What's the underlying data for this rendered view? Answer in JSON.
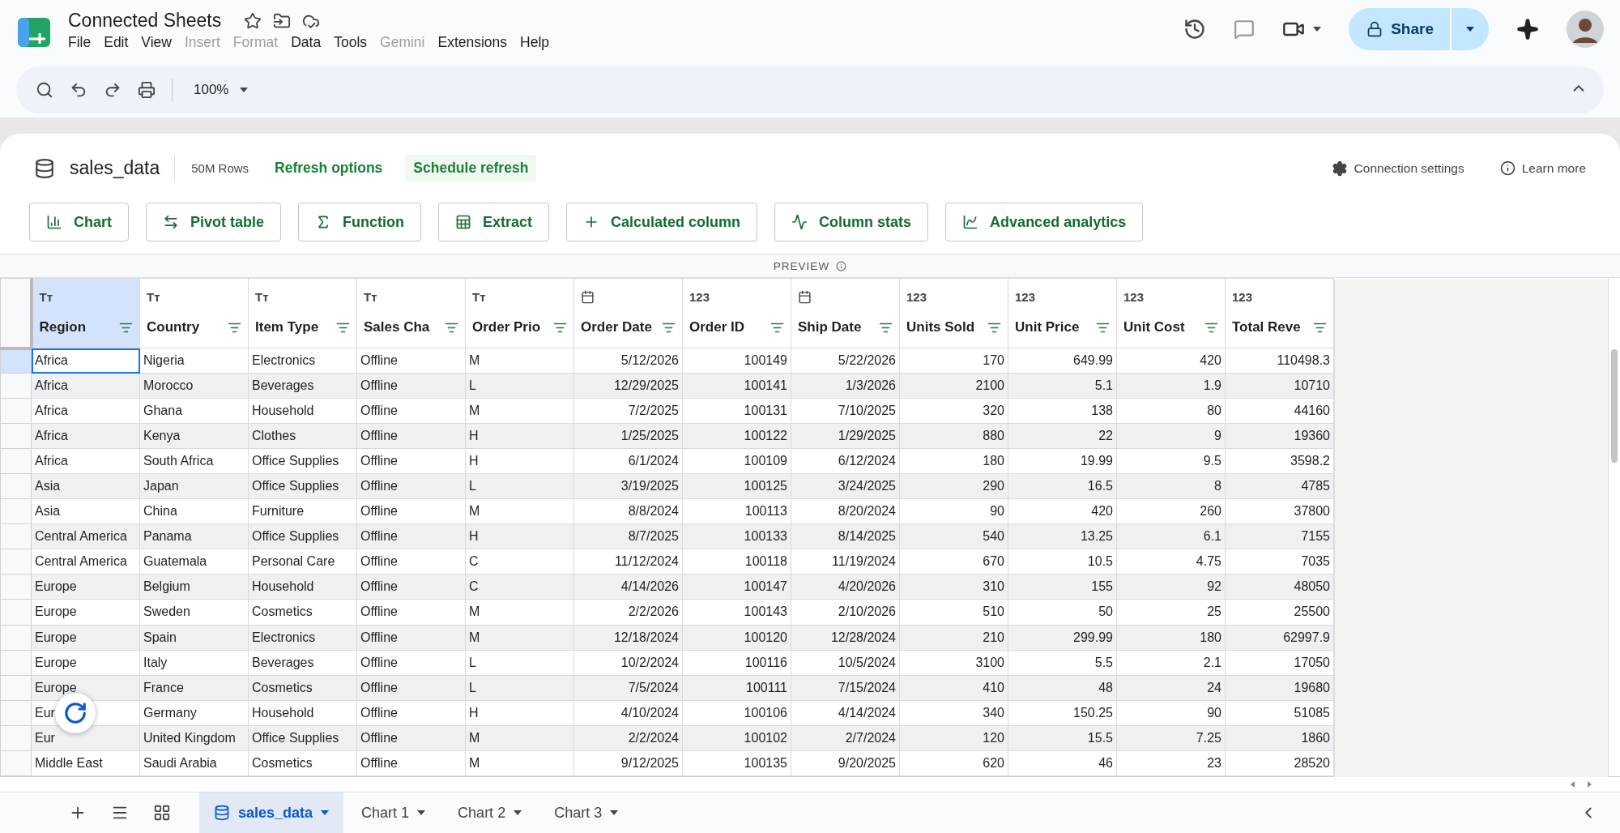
{
  "doc": {
    "title": "Connected Sheets"
  },
  "menu": [
    {
      "label": "File",
      "disabled": false
    },
    {
      "label": "Edit",
      "disabled": false
    },
    {
      "label": "View",
      "disabled": false
    },
    {
      "label": "Insert",
      "disabled": true
    },
    {
      "label": "Format",
      "disabled": true
    },
    {
      "label": "Data",
      "disabled": false
    },
    {
      "label": "Tools",
      "disabled": false
    },
    {
      "label": "Gemini",
      "disabled": true
    },
    {
      "label": "Extensions",
      "disabled": false
    },
    {
      "label": "Help",
      "disabled": false
    }
  ],
  "share": {
    "label": "Share"
  },
  "toolbar": {
    "zoom": "100%"
  },
  "source": {
    "name": "sales_data",
    "rows": "50M Rows",
    "links": [
      "Refresh options",
      "Schedule refresh"
    ],
    "settings": "Connection settings",
    "learn": "Learn more"
  },
  "actions": [
    "Chart",
    "Pivot table",
    "Function",
    "Extract",
    "Calculated column",
    "Column stats",
    "Advanced analytics"
  ],
  "preview": "PREVIEW",
  "table": {
    "columns": [
      {
        "name": "Region",
        "kind": "text",
        "type_label": "Tт",
        "selected": true
      },
      {
        "name": "Country",
        "kind": "text",
        "type_label": "Tт",
        "selected": false
      },
      {
        "name": "Item Type",
        "kind": "text",
        "type_label": "Tт",
        "selected": false
      },
      {
        "name": "Sales Cha",
        "kind": "text",
        "type_label": "Tт",
        "selected": false
      },
      {
        "name": "Order Prio",
        "kind": "text",
        "type_label": "Tт",
        "selected": false
      },
      {
        "name": "Order Date",
        "kind": "date",
        "selected": false
      },
      {
        "name": "Order ID",
        "kind": "number",
        "type_label": "123",
        "selected": false
      },
      {
        "name": "Ship Date",
        "kind": "date",
        "selected": false
      },
      {
        "name": "Units Sold",
        "kind": "number",
        "type_label": "123",
        "selected": false
      },
      {
        "name": "Unit Price",
        "kind": "number",
        "type_label": "123",
        "selected": false
      },
      {
        "name": "Unit Cost",
        "kind": "number",
        "type_label": "123",
        "selected": false
      },
      {
        "name": "Total Reve",
        "kind": "number",
        "type_label": "123",
        "selected": false
      }
    ],
    "rows": [
      {
        "selected": true,
        "cells": [
          "Africa",
          "Nigeria",
          "Electronics",
          "Offline",
          "M",
          "5/12/2026",
          "100149",
          "5/22/2026",
          "170",
          "649.99",
          "420",
          "110498.3"
        ]
      },
      {
        "selected": false,
        "cells": [
          "Africa",
          "Morocco",
          "Beverages",
          "Offline",
          "L",
          "12/29/2025",
          "100141",
          "1/3/2026",
          "2100",
          "5.1",
          "1.9",
          "10710"
        ]
      },
      {
        "selected": false,
        "cells": [
          "Africa",
          "Ghana",
          "Household",
          "Offline",
          "M",
          "7/2/2025",
          "100131",
          "7/10/2025",
          "320",
          "138",
          "80",
          "44160"
        ]
      },
      {
        "selected": false,
        "cells": [
          "Africa",
          "Kenya",
          "Clothes",
          "Offline",
          "H",
          "1/25/2025",
          "100122",
          "1/29/2025",
          "880",
          "22",
          "9",
          "19360"
        ]
      },
      {
        "selected": false,
        "cells": [
          "Africa",
          "South Africa",
          "Office Supplies",
          "Offline",
          "H",
          "6/1/2024",
          "100109",
          "6/12/2024",
          "180",
          "19.99",
          "9.5",
          "3598.2"
        ]
      },
      {
        "selected": false,
        "cells": [
          "Asia",
          "Japan",
          "Office Supplies",
          "Offline",
          "L",
          "3/19/2025",
          "100125",
          "3/24/2025",
          "290",
          "16.5",
          "8",
          "4785"
        ]
      },
      {
        "selected": false,
        "cells": [
          "Asia",
          "China",
          "Furniture",
          "Offline",
          "M",
          "8/8/2024",
          "100113",
          "8/20/2024",
          "90",
          "420",
          "260",
          "37800"
        ]
      },
      {
        "selected": false,
        "cells": [
          "Central America",
          "Panama",
          "Office Supplies",
          "Offline",
          "H",
          "8/7/2025",
          "100133",
          "8/14/2025",
          "540",
          "13.25",
          "6.1",
          "7155"
        ]
      },
      {
        "selected": false,
        "cells": [
          "Central America",
          "Guatemala",
          "Personal Care",
          "Offline",
          "C",
          "11/12/2024",
          "100118",
          "11/19/2024",
          "670",
          "10.5",
          "4.75",
          "7035"
        ]
      },
      {
        "selected": false,
        "cells": [
          "Europe",
          "Belgium",
          "Household",
          "Offline",
          "C",
          "4/14/2026",
          "100147",
          "4/20/2026",
          "310",
          "155",
          "92",
          "48050"
        ]
      },
      {
        "selected": false,
        "cells": [
          "Europe",
          "Sweden",
          "Cosmetics",
          "Offline",
          "M",
          "2/2/2026",
          "100143",
          "2/10/2026",
          "510",
          "50",
          "25",
          "25500"
        ]
      },
      {
        "selected": false,
        "cells": [
          "Europe",
          "Spain",
          "Electronics",
          "Offline",
          "M",
          "12/18/2024",
          "100120",
          "12/28/2024",
          "210",
          "299.99",
          "180",
          "62997.9"
        ]
      },
      {
        "selected": false,
        "cells": [
          "Europe",
          "Italy",
          "Beverages",
          "Offline",
          "L",
          "10/2/2024",
          "100116",
          "10/5/2024",
          "3100",
          "5.5",
          "2.1",
          "17050"
        ]
      },
      {
        "selected": false,
        "cells": [
          "Europe",
          "France",
          "Cosmetics",
          "Offline",
          "L",
          "7/5/2024",
          "100111",
          "7/15/2024",
          "410",
          "48",
          "24",
          "19680"
        ]
      },
      {
        "selected": false,
        "cells": [
          "Eur",
          "Germany",
          "Household",
          "Offline",
          "H",
          "4/10/2024",
          "100106",
          "4/14/2024",
          "340",
          "150.25",
          "90",
          "51085"
        ]
      },
      {
        "selected": false,
        "cells": [
          "Eur",
          "United Kingdom",
          "Office Supplies",
          "Offline",
          "M",
          "2/2/2024",
          "100102",
          "2/7/2024",
          "120",
          "15.5",
          "7.25",
          "1860"
        ]
      },
      {
        "selected": false,
        "cells": [
          "Middle East",
          "Saudi Arabia",
          "Cosmetics",
          "Offline",
          "M",
          "9/12/2025",
          "100135",
          "9/20/2025",
          "620",
          "46",
          "23",
          "28520"
        ]
      }
    ]
  },
  "sheets": [
    {
      "label": "sales_data",
      "kind": "data",
      "selected": true
    },
    {
      "label": "Chart 1",
      "kind": "chart",
      "selected": false
    },
    {
      "label": "Chart 2",
      "kind": "chart",
      "selected": false
    },
    {
      "label": "Chart 3",
      "kind": "chart",
      "selected": false
    }
  ]
}
